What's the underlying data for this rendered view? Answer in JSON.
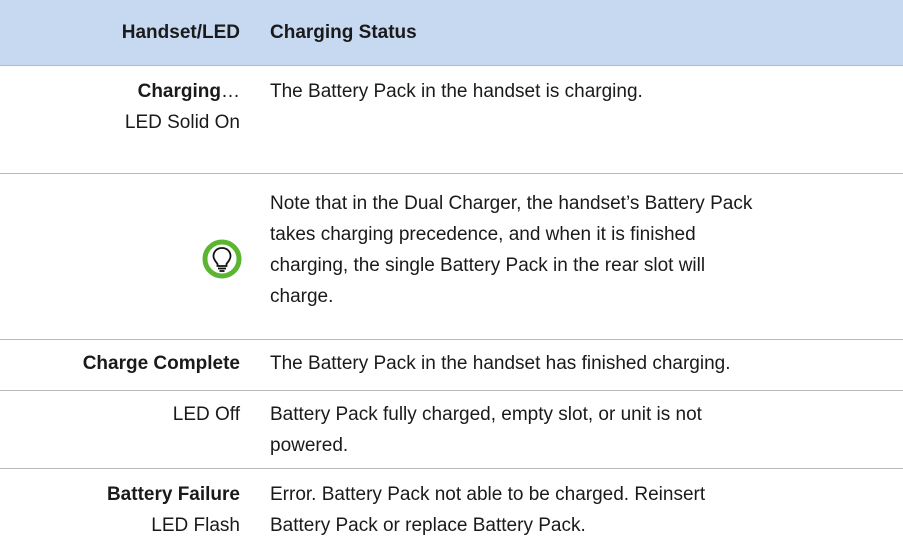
{
  "header": {
    "col1": "Handset/LED",
    "col2": "Charging Status"
  },
  "rows": [
    {
      "left_bold": "Charging",
      "left_suffix": "…",
      "left_sub": "LED Solid On",
      "right": "The Battery Pack in the handset is charging."
    },
    {
      "icon": "lightbulb-tip-icon",
      "right_lines": [
        "Note that in the Dual Charger, the handset’s Battery Pack",
        "takes charging precedence, and when it is finished",
        "charging, the single Battery Pack in the rear slot will",
        "charge."
      ]
    },
    {
      "left_bold": "Charge Complete",
      "right": "The Battery Pack in the handset has finished charging."
    },
    {
      "left": "LED Off",
      "right_lines": [
        "Battery Pack fully charged, empty slot, or unit is not",
        "powered."
      ]
    },
    {
      "left_bold": "Battery Failure",
      "left_sub": "LED Flash",
      "right_lines": [
        "Error. Battery Pack not able to be charged. Reinsert",
        "Battery Pack or replace Battery Pack."
      ]
    }
  ],
  "colors": {
    "header_bg": "#c6d9f1",
    "icon_green": "#5cb531"
  }
}
